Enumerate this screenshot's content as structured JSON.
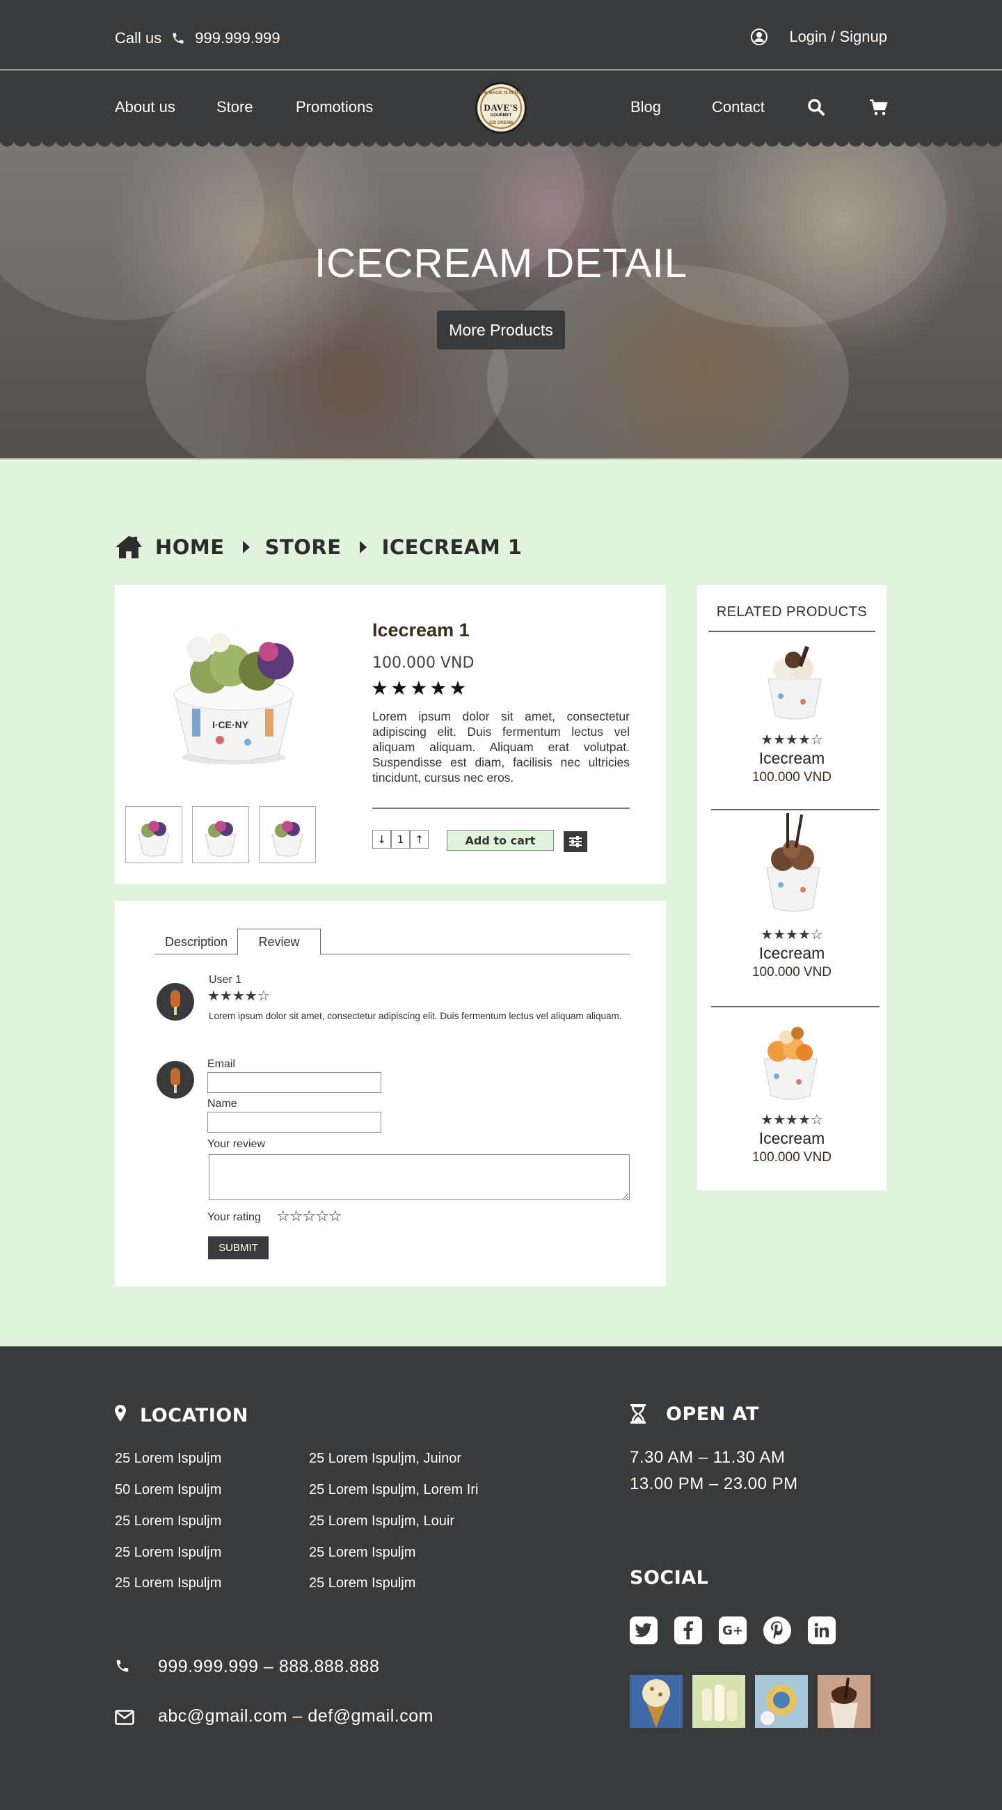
{
  "header": {
    "call_label": "Call us",
    "phone": "999.999.999",
    "login_label": "Login / Signup"
  },
  "nav": {
    "items": [
      "About us",
      "Store",
      "Promotions",
      "Blog",
      "Contact"
    ],
    "logo_name": "DAVE'S",
    "logo_sub": "GOURMET",
    "logo_top": "THE MAGIC IS IN THE",
    "logo_bottom": "ICE CREAM"
  },
  "hero": {
    "title": "ICECREAM DETAIL",
    "button": "More Products"
  },
  "breadcrumb": [
    "HOME",
    "STORE",
    "ICECREAM 1"
  ],
  "product": {
    "name": "Icecream 1",
    "price": "100.000 VND",
    "stars": "★★★★★",
    "rating": 5,
    "description": "Lorem ipsum dolor sit amet, consectetur adipiscing elit. Duis fermentum lectus vel aliquam aliquam. Aliquam erat volutpat. Suspendisse est diam, facilisis nec ultricies tincidunt, cursus nec eros.",
    "quantity": "1",
    "qty_down": "↓",
    "qty_up": "↑",
    "add_to_cart": "Add to cart"
  },
  "reviews": {
    "tabs": [
      "Description",
      "Review"
    ],
    "active_tab": "Review",
    "items": [
      {
        "user": "User 1",
        "stars": "★★★★☆",
        "rating": 4.5,
        "text": "Lorem ipsum dolor sit amet, consectetur adipiscing elit. Duis fermentum lectus vel aliquam aliquam."
      }
    ],
    "form": {
      "email_label": "Email",
      "name_label": "Name",
      "review_label": "Your review",
      "rating_label": "Your rating",
      "rating_stars": "☆☆☆☆☆",
      "submit": "SUBMIT"
    }
  },
  "related": {
    "title": "RELATED PRODUCTS",
    "items": [
      {
        "name": "Icecream",
        "price": "100.000 VND",
        "stars": "★★★★☆",
        "rating": 4.5
      },
      {
        "name": "Icecream",
        "price": "100.000 VND",
        "stars": "★★★★☆",
        "rating": 4.5
      },
      {
        "name": "Icecream",
        "price": "100.000 VND",
        "stars": "★★★★☆",
        "rating": 4.5
      }
    ]
  },
  "footer": {
    "location_title": "LOCATION",
    "addresses_left": [
      "25 Lorem Ispuljm",
      "50 Lorem Ispuljm",
      "25 Lorem Ispuljm",
      "25 Lorem Ispuljm",
      "25 Lorem Ispuljm"
    ],
    "addresses_right": [
      "25 Lorem Ispuljm, Juinor",
      "25 Lorem Ispuljm, Lorem Iri",
      "25 Lorem Ispuljm, Louir",
      "25 Lorem Ispuljm",
      "25 Lorem Ispuljm"
    ],
    "open_title": "OPEN AT",
    "hours": [
      "7.30 AM  – 11.30 AM",
      "13.00 PM  – 23.00 PM"
    ],
    "social_title": "SOCIAL",
    "phones": "999.999.999 – 888.888.888",
    "emails": "abc@gmail.com – def@gmail.com",
    "social_icons": [
      "twitter-icon",
      "facebook-icon",
      "google-plus-icon",
      "pinterest-icon",
      "linkedin-icon"
    ]
  },
  "colors": {
    "dark": "#393a3c",
    "mint": "#e1f2dd",
    "brown": "#3b2b1f"
  }
}
